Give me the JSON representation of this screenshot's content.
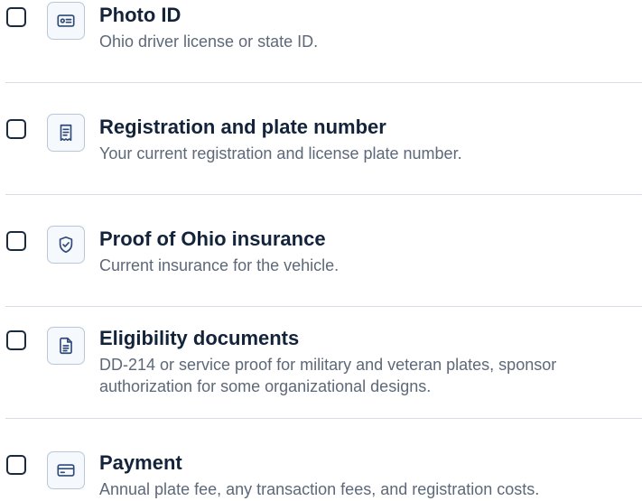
{
  "checklist": {
    "items": [
      {
        "title": "Photo ID",
        "description": "Ohio driver license or state ID.",
        "icon": "id-card-icon"
      },
      {
        "title": "Registration and plate number",
        "description": "Your current registration and license plate number.",
        "icon": "receipt-icon"
      },
      {
        "title": "Proof of Ohio insurance",
        "description": "Current insurance for the vehicle.",
        "icon": "shield-check-icon"
      },
      {
        "title": "Eligibility documents",
        "description": "DD-214 or service proof for military and veteran plates, sponsor authorization for some organizational designs.",
        "icon": "document-icon"
      },
      {
        "title": "Payment",
        "description": "Annual plate fee, any transaction fees, and registration costs.",
        "icon": "credit-card-icon"
      }
    ]
  },
  "colors": {
    "title": "#13233a",
    "description": "#5d6878",
    "checkbox_border": "#1b2a3f",
    "icon_stroke": "#2f4a78",
    "icon_tile_border": "#b9c7d9",
    "icon_tile_bg": "#f5f8fc",
    "divider": "#d9dee6"
  }
}
